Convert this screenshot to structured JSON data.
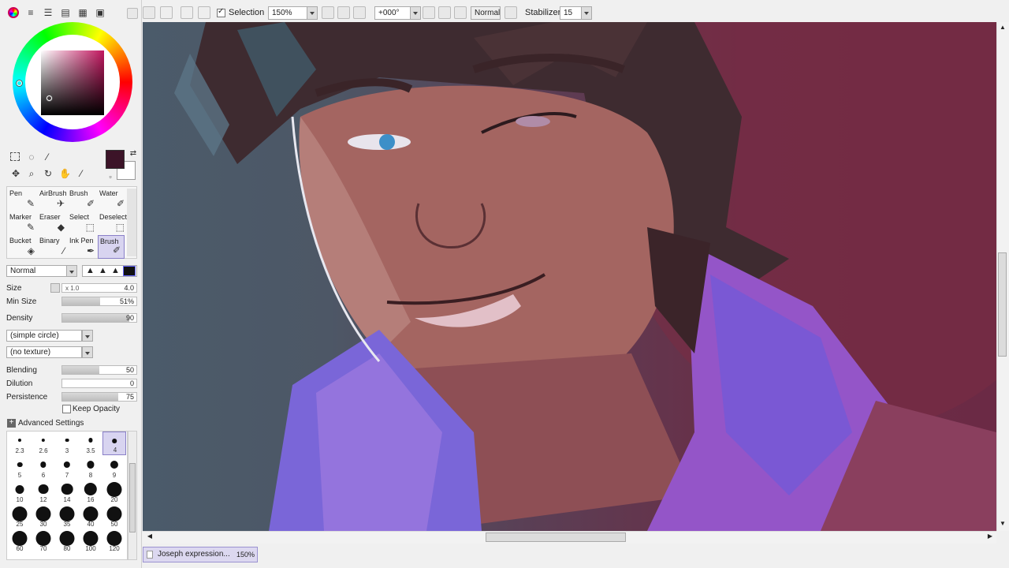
{
  "toolbar": {
    "selection_label": "Selection",
    "selection_checked": true,
    "zoom_value": "150%",
    "rotation_value": "+000°",
    "blend_mode": "Normal",
    "stabilizer_label": "Stabilizer",
    "stabilizer_value": "15",
    "icons": [
      "color-wheel-icon",
      "menu-icon",
      "list-icon",
      "grid-icon",
      "palette-icon",
      "undo-icon",
      "redo-icon",
      "zoom-out-icon",
      "zoom-in-icon",
      "zoom-reset-icon",
      "rotate-left-icon",
      "rotate-right-icon",
      "rotate-reset-icon",
      "flip-icon"
    ]
  },
  "color": {
    "foreground": "#3c1428",
    "background": "#ffffff",
    "hue_color": "#c2165f"
  },
  "tools": {
    "icons": [
      "rect-select-icon",
      "lasso-icon",
      "magic-wand-icon",
      "move-icon",
      "zoom-icon",
      "rotate-icon",
      "hand-icon",
      "eyedropper-icon"
    ]
  },
  "brushes": [
    {
      "label": "Pen",
      "icon": "pen-icon"
    },
    {
      "label": "AirBrush",
      "icon": "airbrush-icon"
    },
    {
      "label": "Brush",
      "icon": "brush-icon"
    },
    {
      "label": "Water",
      "icon": "water-icon"
    },
    {
      "label": "Marker",
      "icon": "marker-icon"
    },
    {
      "label": "Eraser",
      "icon": "eraser-icon"
    },
    {
      "label": "Select",
      "icon": "select-icon"
    },
    {
      "label": "Deselect",
      "icon": "deselect-icon"
    },
    {
      "label": "Bucket",
      "icon": "bucket-icon"
    },
    {
      "label": "Binary",
      "icon": "binary-icon"
    },
    {
      "label": "Ink Pen",
      "icon": "ink-pen-icon"
    },
    {
      "label": "Brush",
      "icon": "brush-icon",
      "selected": true
    }
  ],
  "brush_settings": {
    "blend_mode": "Normal",
    "size_label": "Size",
    "size_multiplier": "x 1.0",
    "size_value": "4.0",
    "min_size_label": "Min Size",
    "min_size_value": "51%",
    "min_size_fraction": 0.51,
    "density_label": "Density",
    "density_value": "90",
    "density_fraction": 0.9,
    "shape": "(simple circle)",
    "texture": "(no texture)",
    "blending_label": "Blending",
    "blending_value": "50",
    "blending_fraction": 0.5,
    "dilution_label": "Dilution",
    "dilution_value": "0",
    "dilution_fraction": 0,
    "persistence_label": "Persistence",
    "persistence_value": "75",
    "persistence_fraction": 0.75,
    "keep_opacity_label": "Keep Opacity",
    "keep_opacity_checked": false,
    "advanced_label": "Advanced Settings"
  },
  "size_presets": [
    "2.3",
    "2.6",
    "3",
    "3.5",
    "4",
    "5",
    "6",
    "7",
    "8",
    "9",
    "10",
    "12",
    "14",
    "16",
    "20",
    "25",
    "30",
    "35",
    "40",
    "50",
    "60",
    "70",
    "80",
    "100",
    "120"
  ],
  "selected_size": "4",
  "document_tab": {
    "name": "Joseph expression...",
    "zoom": "150%"
  }
}
